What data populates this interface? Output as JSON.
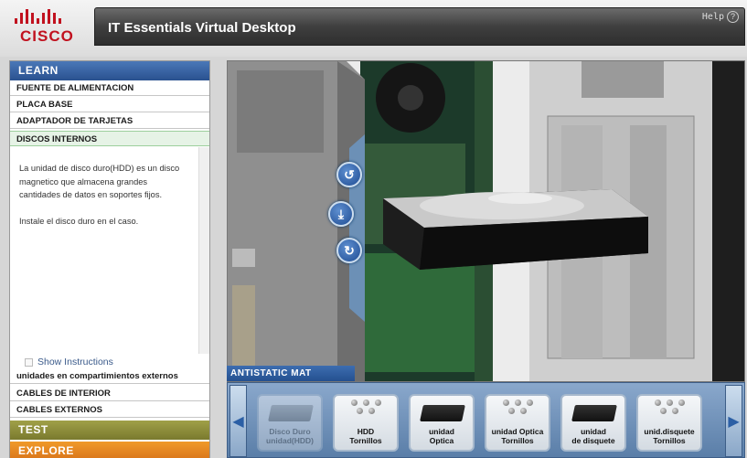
{
  "header": {
    "logo_text": "CISCO",
    "app_title": "IT Essentials Virtual Desktop",
    "help_label": "Help",
    "help_icon": "?"
  },
  "sidebar": {
    "learn_label": "LEARN",
    "items_top": [
      {
        "label": "FUENTE DE ALIMENTACION",
        "active": false
      },
      {
        "label": "PLACA BASE",
        "active": false
      },
      {
        "label": "ADAPTADOR DE TARJETAS",
        "active": false
      },
      {
        "label": "DISCOS INTERNOS",
        "active": true
      }
    ],
    "description": [
      "La unidad de disco duro(HDD) es un disco magnetico que almacena grandes cantidades de datos en soportes fijos.",
      "Instale el disco duro en el caso."
    ],
    "show_instructions": "Show Instructions",
    "items_bottom": [
      {
        "label": "unidades en compartimientos externos"
      },
      {
        "label": "CABLES DE INTERIOR"
      },
      {
        "label": "CABLES EXTERNOS"
      }
    ],
    "test_label": "TEST",
    "explore_label": "EXPLORE"
  },
  "main": {
    "controls": {
      "rotate_ccw": "↺",
      "install": "⤓",
      "rotate_cw": "↻"
    }
  },
  "tray": {
    "label": "ANTISTATIC MAT",
    "left_arrow": "◀",
    "right_arrow": "▶",
    "items": [
      {
        "line1": "Disco Duro",
        "line2": "unidad(HDD)",
        "kind": "hdd",
        "disabled": true
      },
      {
        "line1": "HDD",
        "line2": "Tornillos",
        "kind": "screws",
        "disabled": false
      },
      {
        "line1": "unidad",
        "line2": "Optica",
        "kind": "optical",
        "disabled": false
      },
      {
        "line1": "unidad Optica",
        "line2": "Tornillos",
        "kind": "screws",
        "disabled": false
      },
      {
        "line1": "unidad",
        "line2": "de disquete",
        "kind": "floppy",
        "disabled": false
      },
      {
        "line1": "unid.disquete",
        "line2": "Tornillos",
        "kind": "screws",
        "disabled": false
      }
    ]
  },
  "colors": {
    "cisco_red": "#c1121f",
    "learn_blue": "#2a518f",
    "test_olive": "#7a7a2e",
    "explore_orange": "#d8731a"
  }
}
